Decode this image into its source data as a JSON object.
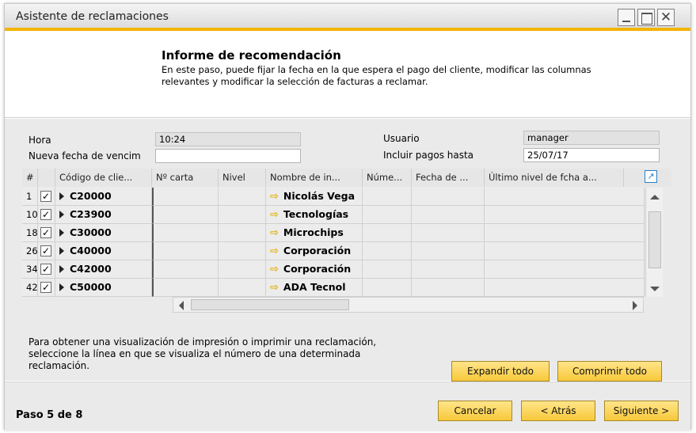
{
  "window": {
    "title": "Asistente de reclamaciones"
  },
  "header": {
    "heading": "Informe de recomendación",
    "description": "En este paso, puede fijar la fecha en la que espera el pago del cliente, modificar las columnas relevantes y modificar la selección de facturas a reclamar."
  },
  "form": {
    "hora_label": "Hora",
    "hora_value": "10:24",
    "nueva_fecha_label": "Nueva fecha de vencim",
    "nueva_fecha_value": "",
    "usuario_label": "Usuario",
    "usuario_value": "manager",
    "incluir_label": "Incluir pagos hasta",
    "incluir_value": "25/07/17"
  },
  "grid": {
    "columns": [
      "#",
      "",
      "Código de clie...",
      "Nº carta",
      "Nivel",
      "Nombre de in...",
      "Núme...",
      "Fecha de ...",
      "Último nivel de fcha a..."
    ],
    "rows": [
      {
        "num": "1",
        "checked": "✓",
        "code": "C20000",
        "name": "Nicolás Vega"
      },
      {
        "num": "10",
        "checked": "✓",
        "code": "C23900",
        "name": "Tecnologías"
      },
      {
        "num": "18",
        "checked": "✓",
        "code": "C30000",
        "name": "Microchips"
      },
      {
        "num": "26",
        "checked": "✓",
        "code": "C40000",
        "name": "Corporación"
      },
      {
        "num": "34",
        "checked": "✓",
        "code": "C42000",
        "name": "Corporación"
      },
      {
        "num": "42",
        "checked": "✓",
        "code": "C50000",
        "name": "ADA Tecnol"
      }
    ]
  },
  "note": "Para obtener una visualización de impresión o imprimir una reclamación, seleccione la línea en que se visualiza el número de una determinada reclamación.",
  "buttons": {
    "expand_all": "Expandir todo",
    "collapse_all": "Comprimir todo",
    "cancel": "Cancelar",
    "back": "< Atrás",
    "next": "Siguiente >"
  },
  "footer": {
    "step": "Paso 5 de 8"
  },
  "colors": {
    "accent": "#f2b300",
    "button": "#f7c83a",
    "link_icon": "#2a7fc2"
  }
}
